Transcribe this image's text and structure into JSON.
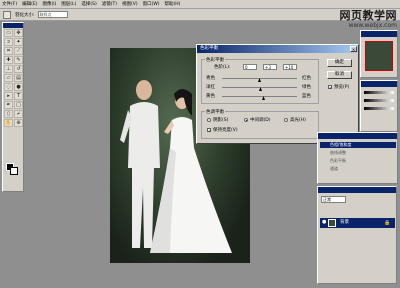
{
  "menu": [
    "文件(F)",
    "编辑(E)",
    "图像(I)",
    "图层(L)",
    "选择(S)",
    "滤镜(T)",
    "视图(V)",
    "窗口(W)",
    "帮助(H)"
  ],
  "options": {
    "label": "羽化大小:",
    "value": "取样点"
  },
  "watermark": {
    "title": "网页教学网",
    "url": "www.webjx.com"
  },
  "dialog": {
    "title": "色彩平衡",
    "group_balance": "色彩平衡",
    "levels_label": "色阶(L):",
    "levels": [
      "0",
      "+3",
      "+10"
    ],
    "sliders": [
      {
        "left": "青色",
        "right": "红色",
        "value": 0
      },
      {
        "left": "洋红",
        "right": "绿色",
        "value": 3
      },
      {
        "left": "黄色",
        "right": "蓝色",
        "value": 10
      }
    ],
    "group_tone": "色调平衡",
    "tone_options": [
      "阴影(S)",
      "中间调(D)",
      "高光(H)"
    ],
    "preserve": "保持亮度(V)",
    "ok": "确定",
    "cancel": "取消",
    "preview": "预览(P)"
  },
  "history": {
    "items": [
      "色相/饱和度",
      "曲线调整",
      "色彩平衡",
      "通道"
    ]
  },
  "layers": {
    "mode": "正常",
    "layer_name": "背景"
  }
}
